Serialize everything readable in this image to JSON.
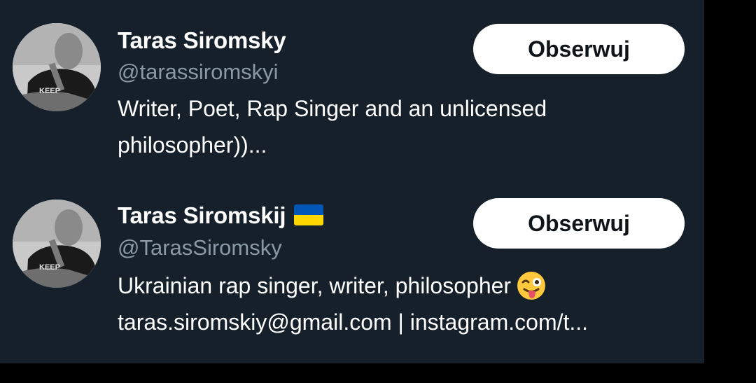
{
  "users": [
    {
      "display_name": "Taras Siromsky",
      "handle": "@tarassiromskyi",
      "bio_lines": [
        "Writer, Poet, Rap Singer and an unlicensed",
        "philosopher))..."
      ],
      "follow_label": "Obserwuj",
      "avatar_icon": "profile-photo"
    },
    {
      "display_name": "Taras Siromskij",
      "name_badge_icon": "ukraine-flag-icon",
      "handle": "@TarasSiromsky",
      "bio_lines": [
        "Ukrainian rap singer, writer, philosopher",
        "taras.siromskiy@gmail.com | instagram.com/t..."
      ],
      "bio_emoji_icon": "winking-face-with-tongue-icon",
      "follow_label": "Obserwuj",
      "avatar_icon": "profile-photo"
    }
  ],
  "colors": {
    "background": "#15202b",
    "outer": "#000000",
    "text_primary": "#ffffff",
    "text_secondary": "#8b98a5",
    "button_bg": "#ffffff",
    "button_text": "#0f1419",
    "flag_blue": "#0057b7",
    "flag_yellow": "#ffd700",
    "emoji_yellow": "#ffc83d"
  }
}
